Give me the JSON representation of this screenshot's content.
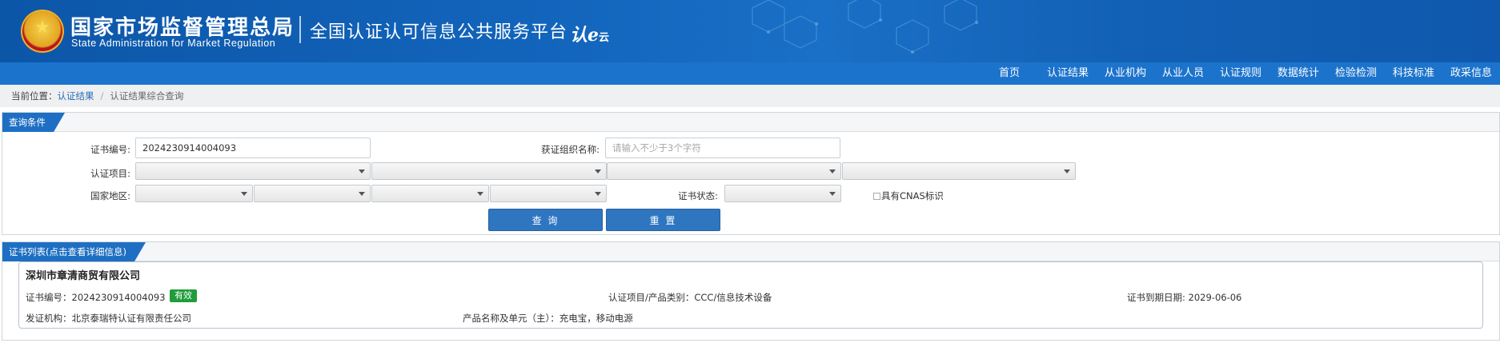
{
  "header": {
    "org_title": "国家市场监督管理总局",
    "org_subtitle": "State Administration for Market Regulation",
    "platform_title": "全国认证认可信息公共服务平台",
    "platform_logo": "认e",
    "platform_logo_suffix": "云",
    "emblem_icon": "national-emblem-icon"
  },
  "nav": {
    "items": [
      "首页",
      "认证结果",
      "从业机构",
      "从业人员",
      "认证规则",
      "数据统计",
      "检验检测",
      "科技标准",
      "政采信息"
    ]
  },
  "breadcrumb": {
    "prefix": "当前位置：",
    "link": "认证结果",
    "separator": "/",
    "current": "认证结果综合查询"
  },
  "query": {
    "tab_label": "查询条件",
    "cert_no_label": "证书编号:",
    "cert_no_value": "2024230914004093",
    "org_name_label": "获证组织名称:",
    "org_name_placeholder": "请输入不少于3个字符",
    "project_label": "认证项目:",
    "region_label": "国家地区:",
    "status_label": "证书状态:",
    "cnas_label": "具有CNAS标识",
    "search_button": "查 询",
    "reset_button": "重 置"
  },
  "results": {
    "tab_label": "证书列表(点击查看详细信息)",
    "items": [
      {
        "company": "深圳市章清商贸有限公司",
        "cert_no": "证书编号：2024230914004093",
        "status": "有效",
        "project": "认证项目/产品类别：CCC/信息技术设备",
        "expiry": "证书到期日期: 2029-06-06",
        "issuer": "发证机构：北京泰瑞特认证有限责任公司",
        "product": "产品名称及单元（主）：充电宝，移动电源"
      }
    ]
  },
  "colors": {
    "header_blue": "#1264bb",
    "nav_blue": "#1c73cc",
    "tab_blue": "#1e6fc3",
    "button_blue": "#2f76c1",
    "badge_green": "#1f9d3a"
  }
}
